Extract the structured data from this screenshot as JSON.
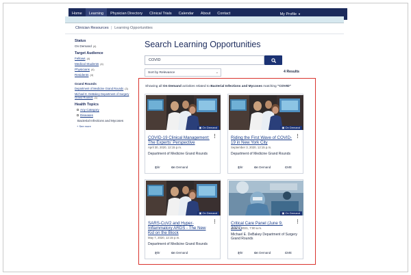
{
  "nav": {
    "items": [
      "Home",
      "Learning",
      "Physician Directory",
      "Clinical Trials",
      "Calendar",
      "About",
      "Contact"
    ],
    "active_index": 1,
    "profile": "My Profile"
  },
  "breadcrumb": {
    "parent": "Clinician Resources",
    "sep": "|",
    "current": "Learning Opportunities"
  },
  "sidebar": {
    "status": {
      "heading": "Status",
      "items": [
        {
          "label": "On Demand",
          "count": "(4)"
        }
      ]
    },
    "audience": {
      "heading": "Target Audience",
      "items": [
        {
          "label": "Fellows",
          "count": "(4)"
        },
        {
          "label": "Medical Students",
          "count": "(4)"
        },
        {
          "label": "Physicians",
          "count": "(4)"
        },
        {
          "label": "Residents",
          "count": "(4)"
        }
      ]
    },
    "grand_rounds": {
      "heading": "Grand Rounds",
      "items": [
        {
          "label": "Department of Medicine Grand Rounds",
          "count": "(3)"
        },
        {
          "label": "Michael E. DeBakey Department of Surgery Grand Rounds",
          "count": "(1)"
        }
      ]
    },
    "health_topics": {
      "heading": "Health Topics",
      "any": "Any Category",
      "diseases": "Diseases",
      "selected": "Bacterial Infections and Mycoses",
      "see_more": "+ See more"
    }
  },
  "main": {
    "title": "Search Learning Opportunities",
    "search_value": "COVID",
    "sort_label": "Sort by Relevance",
    "results_count": "4 Results",
    "showing": {
      "pre": "Showing all ",
      "status": "On Demand",
      "mid": " activities related to ",
      "topic": "Bacterial Infections and Mycoses",
      "post": " matching ",
      "query": "\"COVID\""
    }
  },
  "cards": [
    {
      "title": "COVID-19 Clinical Management: The Experts' Perspective",
      "date": "April 30, 2020, 12:15 p.m.",
      "org": "Department of Medicine Grand Rounds",
      "badge": "On Demand",
      "duration": "1 hr",
      "format": "On Demand",
      "cme": "",
      "image": "doctors-at-monitor"
    },
    {
      "title": "Riding the First Wave of COVID-19 in New York City",
      "date": "September 3, 2020, 12:15 p.m.",
      "org": "Department of Medicine Grand Rounds",
      "badge": "On Demand",
      "duration": "1 hr",
      "format": "On Demand",
      "cme": "CME",
      "image": "doctors-at-monitor"
    },
    {
      "title": "SARS-CoV2 and Hyper-Inflammatory ARDS - The New Kid on the Block",
      "date": "May 7, 2020, 12:15 p.m.",
      "org": "Department of Medicine Grand Rounds",
      "badge": "On Demand",
      "duration": "1 hr",
      "format": "On Demand",
      "cme": "",
      "image": "doctors-at-monitor"
    },
    {
      "title": "Critical Care Panel (June 9, 2021)",
      "date": "June 9, 2021, 7:00 a.m.",
      "org": "Michael E. DeBakey Department of Surgery Grand Rounds",
      "badge": "On Demand",
      "duration": "1 hr",
      "format": "On Demand",
      "cme": "CME",
      "image": "surgeon-in-operating-room"
    }
  ],
  "colors": {
    "navy": "#1b2a5b",
    "button": "#1b3273",
    "highlight_border": "#d9322c",
    "subnav": "#d7e8ef"
  }
}
